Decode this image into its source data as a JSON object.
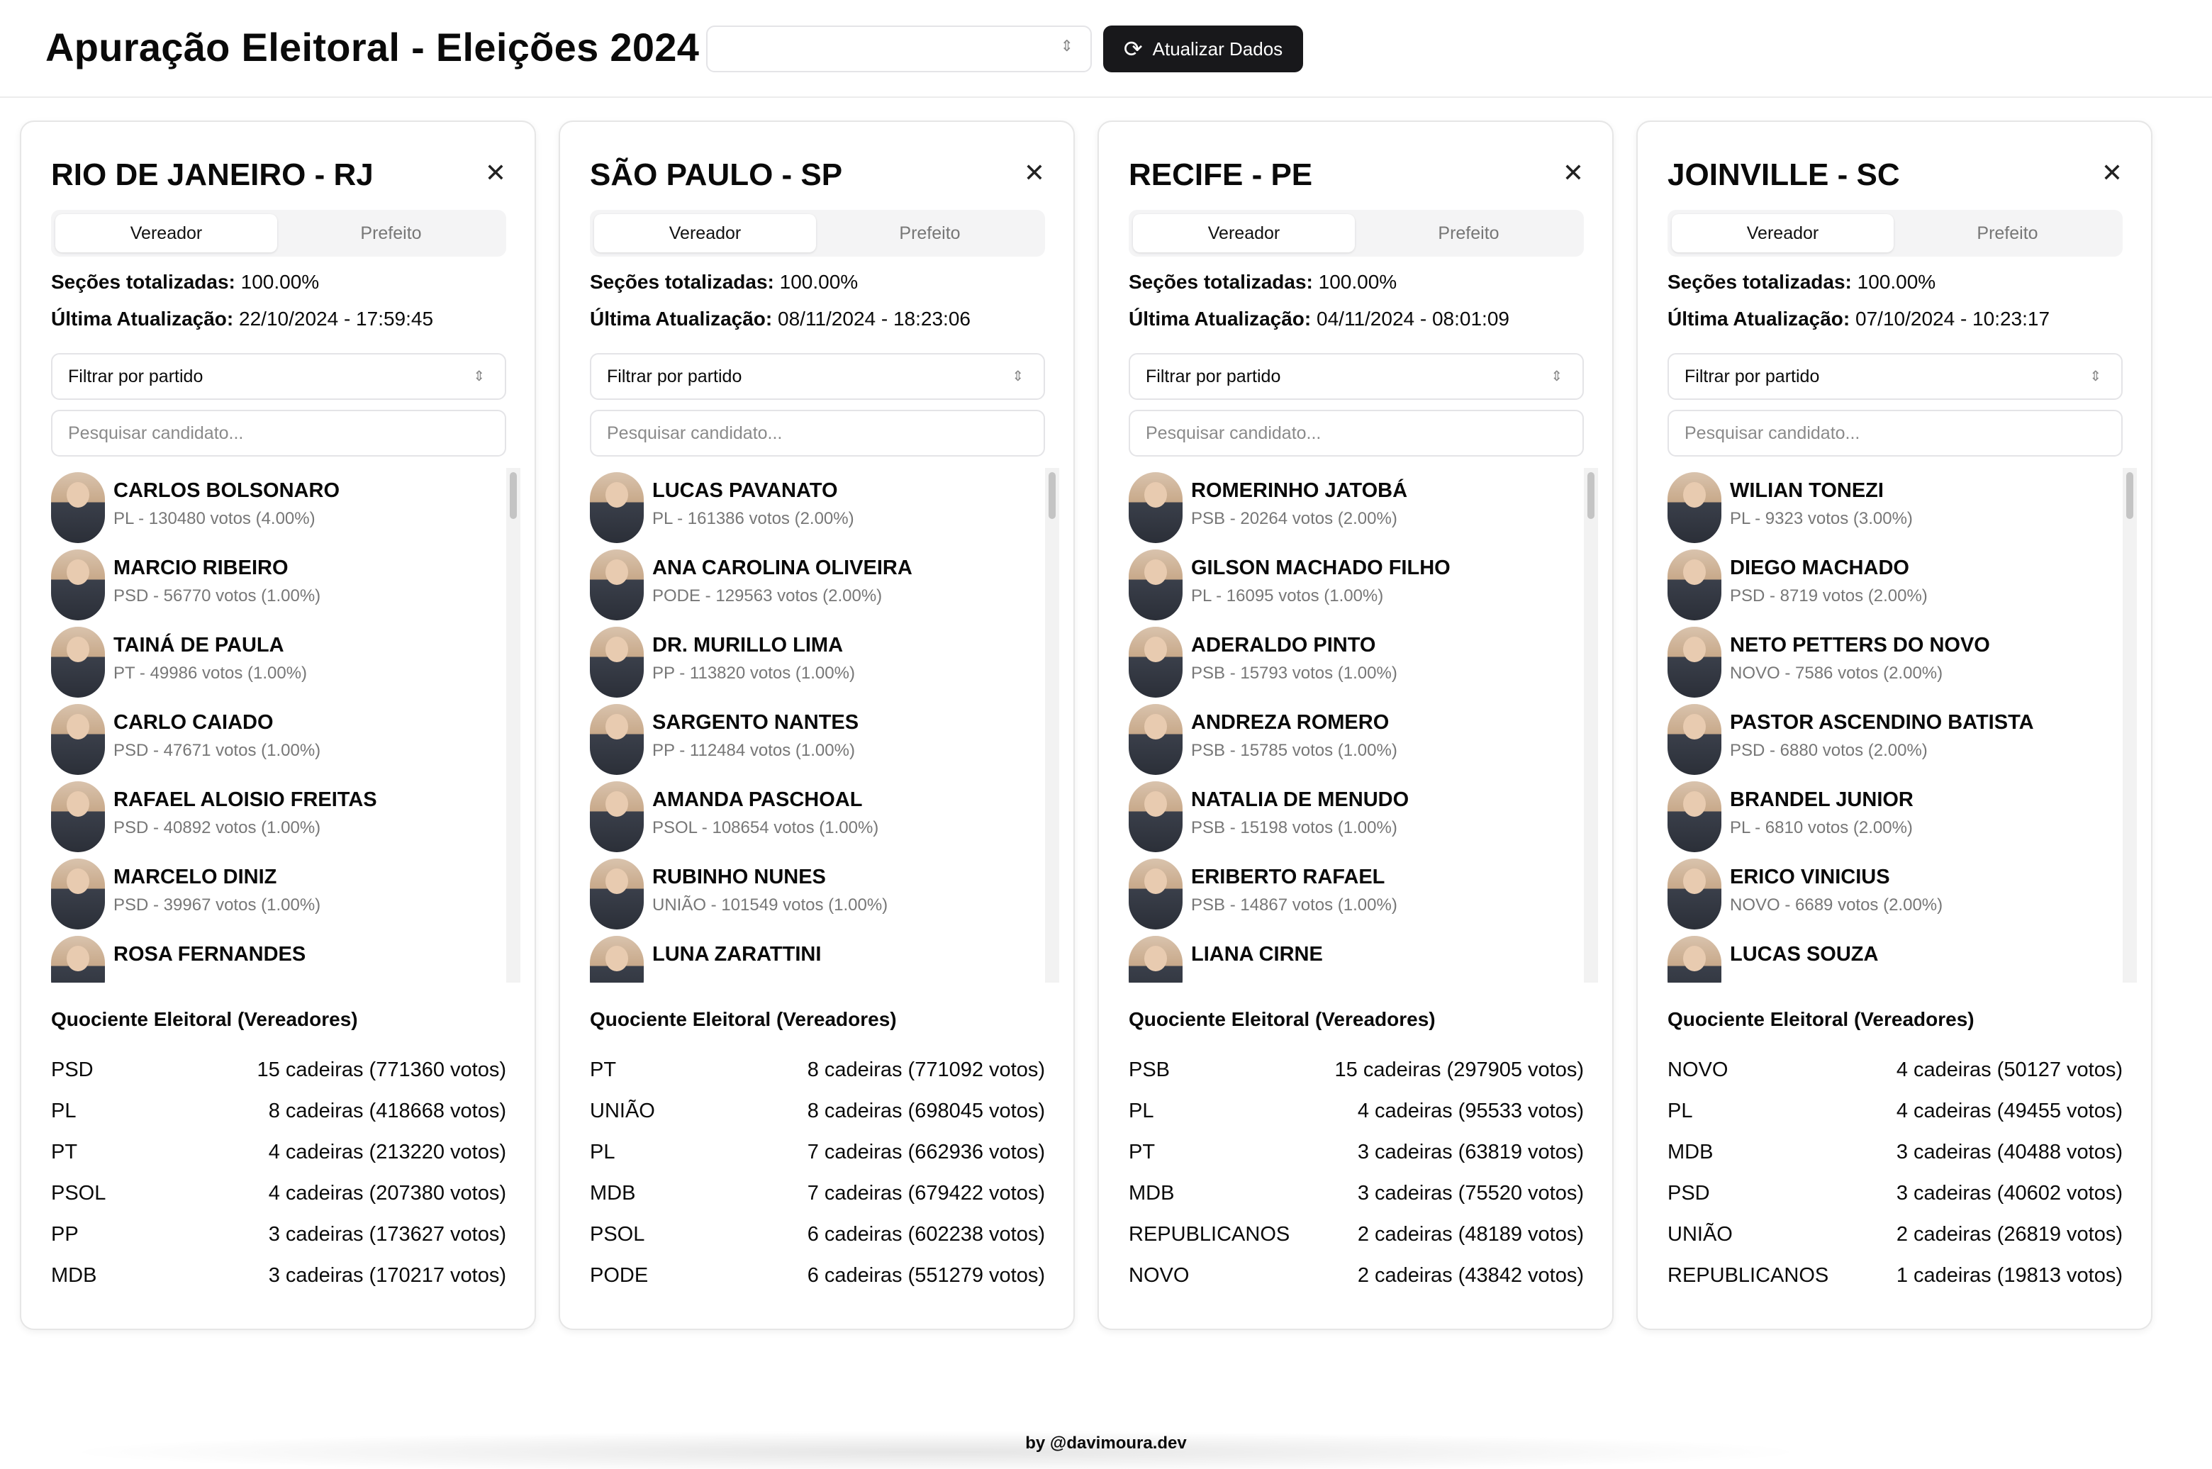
{
  "app": {
    "title": "Apuração Eleitoral - Eleições 2024",
    "refresh_label": "Atualizar Dados"
  },
  "footer": "by @davimoura.dev",
  "labels": {
    "tab_vereador": "Vereador",
    "tab_prefeito": "Prefeito",
    "secoes_label": "Seções totalizadas:",
    "ultima_label": "Última Atualização:",
    "party_filter": "Filtrar por partido",
    "search_placeholder": "Pesquisar candidato...",
    "quotient_title": "Quociente Eleitoral (Vereadores)"
  },
  "cards": [
    {
      "title": "RIO DE JANEIRO - RJ",
      "secoes": "100.00%",
      "updated": "22/10/2024 - 17:59:45",
      "candidates": [
        {
          "name": "CARLOS BOLSONARO",
          "meta": "PL - 130480 votos (4.00%)"
        },
        {
          "name": "MARCIO RIBEIRO",
          "meta": "PSD - 56770 votos (1.00%)"
        },
        {
          "name": "TAINÁ DE PAULA",
          "meta": "PT - 49986 votos (1.00%)"
        },
        {
          "name": "CARLO CAIADO",
          "meta": "PSD - 47671 votos (1.00%)"
        },
        {
          "name": "RAFAEL ALOISIO FREITAS",
          "meta": "PSD - 40892 votos (1.00%)"
        },
        {
          "name": "MARCELO DINIZ",
          "meta": "PSD - 39967 votos (1.00%)"
        },
        {
          "name": "ROSA FERNANDES",
          "meta": ""
        }
      ],
      "quotient": [
        {
          "party": "PSD",
          "value": "15 cadeiras (771360 votos)"
        },
        {
          "party": "PL",
          "value": "8 cadeiras (418668 votos)"
        },
        {
          "party": "PT",
          "value": "4 cadeiras (213220 votos)"
        },
        {
          "party": "PSOL",
          "value": "4 cadeiras (207380 votos)"
        },
        {
          "party": "PP",
          "value": "3 cadeiras (173627 votos)"
        },
        {
          "party": "MDB",
          "value": "3 cadeiras (170217 votos)"
        }
      ]
    },
    {
      "title": "SÃO PAULO - SP",
      "secoes": "100.00%",
      "updated": "08/11/2024 - 18:23:06",
      "candidates": [
        {
          "name": "LUCAS PAVANATO",
          "meta": "PL - 161386 votos (2.00%)"
        },
        {
          "name": "ANA CAROLINA OLIVEIRA",
          "meta": "PODE - 129563 votos (2.00%)"
        },
        {
          "name": "DR. MURILLO LIMA",
          "meta": "PP - 113820 votos (1.00%)"
        },
        {
          "name": "SARGENTO NANTES",
          "meta": "PP - 112484 votos (1.00%)"
        },
        {
          "name": "AMANDA PASCHOAL",
          "meta": "PSOL - 108654 votos (1.00%)"
        },
        {
          "name": "RUBINHO NUNES",
          "meta": "UNIÃO - 101549 votos (1.00%)"
        },
        {
          "name": "LUNA ZARATTINI",
          "meta": ""
        }
      ],
      "quotient": [
        {
          "party": "PT",
          "value": "8 cadeiras (771092 votos)"
        },
        {
          "party": "UNIÃO",
          "value": "8 cadeiras (698045 votos)"
        },
        {
          "party": "PL",
          "value": "7 cadeiras (662936 votos)"
        },
        {
          "party": "MDB",
          "value": "7 cadeiras (679422 votos)"
        },
        {
          "party": "PSOL",
          "value": "6 cadeiras (602238 votos)"
        },
        {
          "party": "PODE",
          "value": "6 cadeiras (551279 votos)"
        }
      ]
    },
    {
      "title": "RECIFE - PE",
      "secoes": "100.00%",
      "updated": "04/11/2024 - 08:01:09",
      "candidates": [
        {
          "name": "ROMERINHO JATOBÁ",
          "meta": "PSB - 20264 votos (2.00%)"
        },
        {
          "name": "GILSON MACHADO FILHO",
          "meta": "PL - 16095 votos (1.00%)"
        },
        {
          "name": "ADERALDO PINTO",
          "meta": "PSB - 15793 votos (1.00%)"
        },
        {
          "name": "ANDREZA ROMERO",
          "meta": "PSB - 15785 votos (1.00%)"
        },
        {
          "name": "NATALIA DE MENUDO",
          "meta": "PSB - 15198 votos (1.00%)"
        },
        {
          "name": "ERIBERTO RAFAEL",
          "meta": "PSB - 14867 votos (1.00%)"
        },
        {
          "name": "LIANA CIRNE",
          "meta": ""
        }
      ],
      "quotient": [
        {
          "party": "PSB",
          "value": "15 cadeiras (297905 votos)"
        },
        {
          "party": "PL",
          "value": "4 cadeiras (95533 votos)"
        },
        {
          "party": "PT",
          "value": "3 cadeiras (63819 votos)"
        },
        {
          "party": "MDB",
          "value": "3 cadeiras (75520 votos)"
        },
        {
          "party": "REPUBLICANOS",
          "value": "2 cadeiras (48189 votos)"
        },
        {
          "party": "NOVO",
          "value": "2 cadeiras (43842 votos)"
        }
      ]
    },
    {
      "title": "JOINVILLE - SC",
      "secoes": "100.00%",
      "updated": "07/10/2024 - 10:23:17",
      "candidates": [
        {
          "name": "WILIAN TONEZI",
          "meta": "PL - 9323 votos (3.00%)"
        },
        {
          "name": "DIEGO MACHADO",
          "meta": "PSD - 8719 votos (2.00%)"
        },
        {
          "name": "NETO PETTERS DO NOVO",
          "meta": "NOVO - 7586 votos (2.00%)"
        },
        {
          "name": "PASTOR ASCENDINO BATISTA",
          "meta": "PSD - 6880 votos (2.00%)"
        },
        {
          "name": "BRANDEL JUNIOR",
          "meta": "PL - 6810 votos (2.00%)"
        },
        {
          "name": "ERICO VINICIUS",
          "meta": "NOVO - 6689 votos (2.00%)"
        },
        {
          "name": "LUCAS SOUZA",
          "meta": ""
        }
      ],
      "quotient": [
        {
          "party": "NOVO",
          "value": "4 cadeiras (50127 votos)"
        },
        {
          "party": "PL",
          "value": "4 cadeiras (49455 votos)"
        },
        {
          "party": "MDB",
          "value": "3 cadeiras (40488 votos)"
        },
        {
          "party": "PSD",
          "value": "3 cadeiras (40602 votos)"
        },
        {
          "party": "UNIÃO",
          "value": "2 cadeiras (26819 votos)"
        },
        {
          "party": "REPUBLICANOS",
          "value": "1 cadeiras (19813 votos)"
        }
      ]
    }
  ]
}
